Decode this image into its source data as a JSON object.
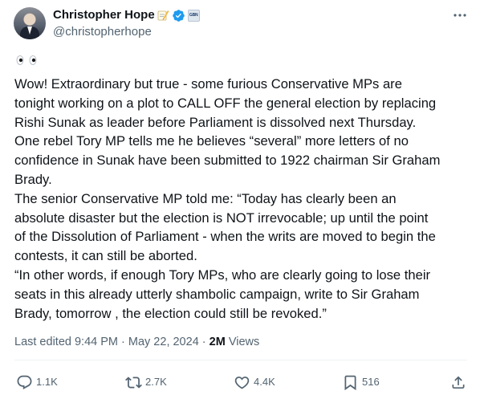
{
  "author": {
    "display_name": "Christopher Hope",
    "handle": "@christopherhope",
    "name_emoji": "memo-pencil-icon",
    "verified": true,
    "affiliation_badge_text": "GBN"
  },
  "tweet": {
    "leading_emoji": "eyes-emoji",
    "lines": [
      "Wow! Extraordinary but true - some furious Conservative MPs are",
      "tonight working on a plot to CALL OFF the general election by replacing",
      "Rishi Sunak as leader before Parliament is dissolved next Thursday.",
      "One rebel Tory MP tells me he believes “several” more letters of no",
      "confidence in Sunak have been submitted to 1922 chairman Sir Graham",
      "Brady.",
      "The senior Conservative MP told me: “Today has clearly been an",
      "absolute disaster but the election is NOT irrevocable; up until the point",
      "of the Dissolution of Parliament - when the writs are moved to begin the",
      "contests, it can still be aborted.",
      "“In other words, if enough Tory MPs, who are clearly going to lose their",
      "seats in this already utterly shambolic campaign, write to Sir Graham",
      "Brady, tomorrow , the election could still be revoked.”"
    ]
  },
  "meta": {
    "edited_label": "Last edited",
    "time": "9:44 PM",
    "separator": "·",
    "date": "May 22, 2024",
    "views_count": "2M",
    "views_label": "Views"
  },
  "actions": {
    "reply_count": "1.1K",
    "repost_count": "2.7K",
    "like_count": "4.4K",
    "bookmark_count": "516"
  },
  "colors": {
    "text": "#0f1419",
    "secondary": "#536471",
    "verified_blue": "#1d9bf0",
    "divider": "#eff3f4"
  }
}
